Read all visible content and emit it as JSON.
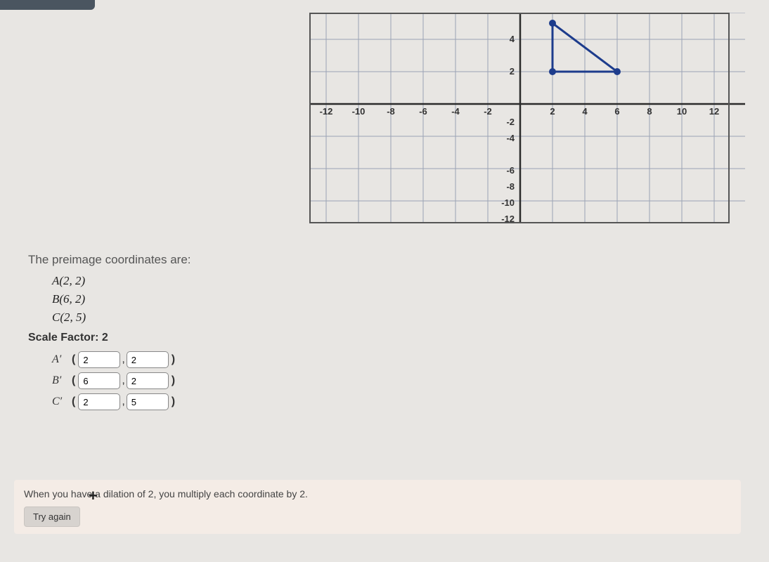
{
  "graph": {
    "x_ticks": [
      -12,
      -10,
      -8,
      -6,
      -4,
      -2,
      2,
      4,
      6,
      8,
      10,
      12
    ],
    "y_ticks_pos": [
      2,
      4
    ],
    "y_ticks_neg": [
      -2,
      -4,
      -6,
      -8,
      -10,
      -12
    ],
    "triangle": {
      "A": [
        2,
        2
      ],
      "B": [
        6,
        2
      ],
      "C": [
        2,
        5
      ]
    }
  },
  "heading": "The preimage coordinates are:",
  "preimage": {
    "A": "A(2, 2)",
    "B": "B(6, 2)",
    "C": "C(2, 5)"
  },
  "scale_label": "Scale Factor: 2",
  "answers": {
    "Ap": {
      "label": "A′",
      "x": "2",
      "y": "2"
    },
    "Bp": {
      "label": "B′",
      "x": "6",
      "y": "2"
    },
    "Cp": {
      "label": "C′",
      "x": "2",
      "y": "5"
    }
  },
  "footer_msg": "When you have a dilation of 2, you multiply each coordinate by 2.",
  "try_again": "Try again"
}
